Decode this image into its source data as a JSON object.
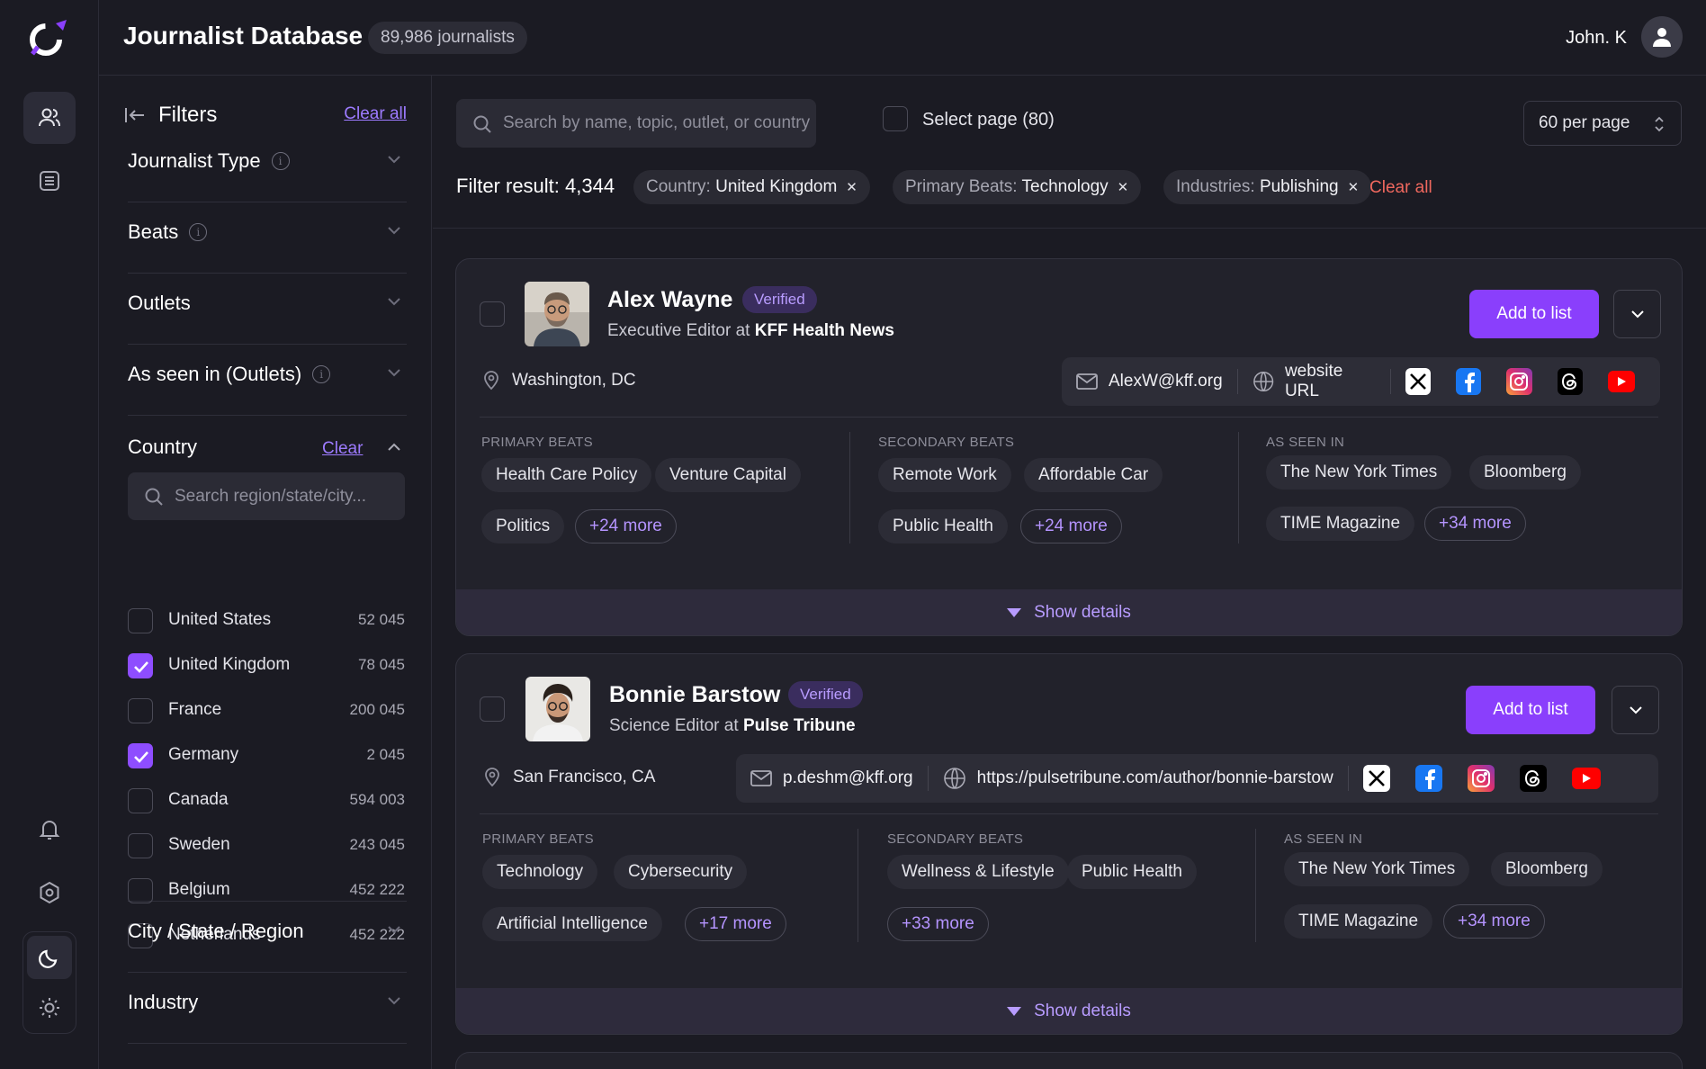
{
  "header": {
    "title": "Journalist Database",
    "count_badge": "89,986 journalists",
    "user_name": "John. K"
  },
  "rail": {
    "icons": [
      "logo",
      "users-icon",
      "list-icon",
      "bell-icon",
      "settings-icon",
      "moon-icon",
      "sun-icon"
    ]
  },
  "filters": {
    "title": "Filters",
    "clear_all": "Clear all",
    "sections": {
      "journalist_type": "Journalist Type",
      "beats": "Beats",
      "outlets": "Outlets",
      "as_seen_in": "As seen in (Outlets)",
      "country": "Country",
      "city": "City / State / Region",
      "industry": "Industry"
    },
    "country_clear": "Clear",
    "country_search_placeholder": "Search region/state/city...",
    "countries": [
      {
        "name": "United States",
        "count": "52 045",
        "checked": false
      },
      {
        "name": "United Kingdom",
        "count": "78 045",
        "checked": true
      },
      {
        "name": "France",
        "count": "200 045",
        "checked": false
      },
      {
        "name": "Germany",
        "count": "2 045",
        "checked": true
      },
      {
        "name": "Canada",
        "count": "594 003",
        "checked": false
      },
      {
        "name": "Sweden",
        "count": "243 045",
        "checked": false
      },
      {
        "name": "Belgium",
        "count": "452 222",
        "checked": false
      },
      {
        "name": "Netherlands",
        "count": "452 222",
        "checked": false
      }
    ]
  },
  "toolbar": {
    "search_placeholder": "Search by name, topic, outlet, or country",
    "select_page": "Select page (80)",
    "per_page": "60 per page",
    "filter_result": "Filter result: 4,344",
    "chips": [
      {
        "key": "Country:",
        "value": "United Kingdom"
      },
      {
        "key": "Primary Beats:",
        "value": "Technology"
      },
      {
        "key": "Industries:",
        "value": "Publishing"
      }
    ],
    "clear_all": "Clear all"
  },
  "labels": {
    "verified": "Verified",
    "add_to_list": "Add to list",
    "primary_beats": "PRIMARY BEATS",
    "secondary_beats": "SECONDARY  BEATS",
    "as_seen_in": "AS SEEN IN",
    "show_details": "Show details",
    "at": "at"
  },
  "cards": [
    {
      "name": "Alex Wayne",
      "role": "Executive Editor",
      "outlet": "KFF Health News",
      "location": "Washington, DC",
      "email": "AlexW@kff.org",
      "website": "website URL",
      "primary_beats": [
        "Health Care Policy",
        "Venture Capital",
        "Politics"
      ],
      "primary_more": "+24 more",
      "secondary_beats": [
        "Remote Work",
        "Affordable Car",
        "Public Health"
      ],
      "secondary_more": "+24 more",
      "seen_in": [
        "The New York Times",
        "Bloomberg",
        "TIME Magazine"
      ],
      "seen_more": "+34 more"
    },
    {
      "name": "Bonnie Barstow",
      "role": "Science Editor",
      "outlet": "Pulse Tribune",
      "location": "San Francisco, CA",
      "email": "p.deshm@kff.org",
      "website": "https://pulsetribune.com/author/bonnie-barstow",
      "primary_beats": [
        "Technology",
        "Cybersecurity",
        "Artificial Intelligence"
      ],
      "primary_more": "+17 more",
      "secondary_beats": [
        "Wellness & Lifestyle",
        "Public Health"
      ],
      "secondary_more": "+33 more",
      "seen_in": [
        "The New York Times",
        "Bloomberg",
        "TIME Magazine"
      ],
      "seen_more": "+34 more"
    }
  ],
  "colors": {
    "accent": "#8a3ffc",
    "background": "#1b1b23",
    "card": "#22222b",
    "danger": "#f0685e"
  }
}
